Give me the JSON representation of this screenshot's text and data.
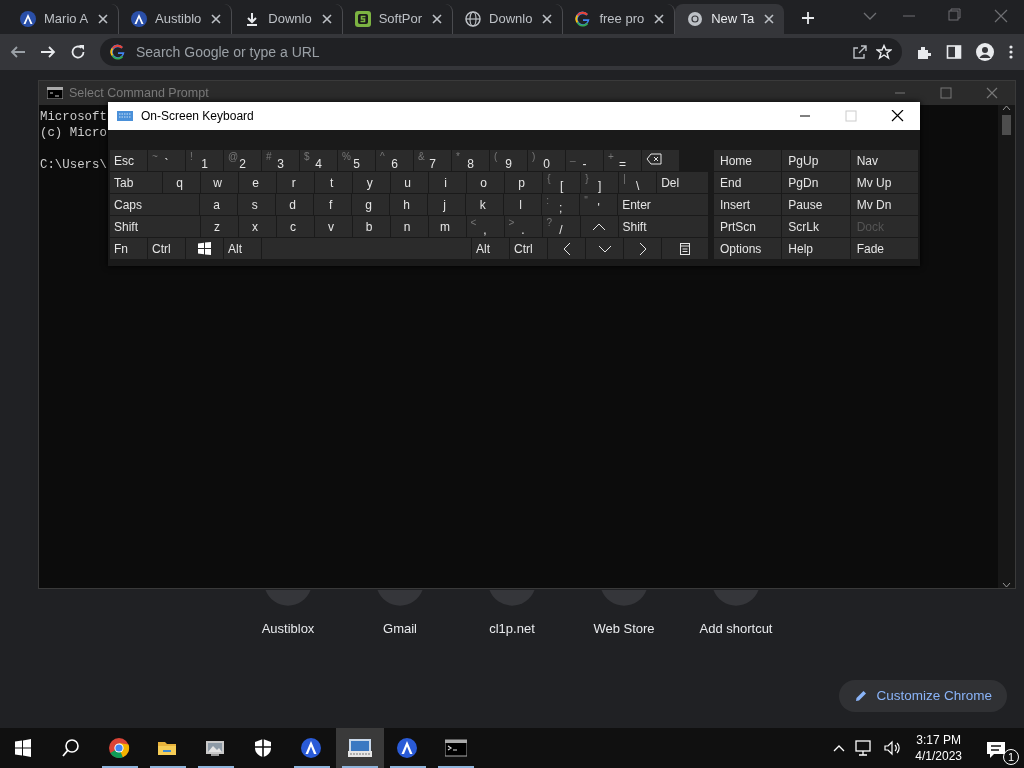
{
  "browser": {
    "tabs": [
      {
        "kind": "a-logo",
        "title": "Mario A",
        "selected": false
      },
      {
        "kind": "a-logo",
        "title": "Austiblo",
        "selected": false
      },
      {
        "kind": "download",
        "title": "Downlo",
        "selected": false
      },
      {
        "kind": "s-logo",
        "title": "SoftPor",
        "selected": false
      },
      {
        "kind": "globe",
        "title": "Downlo",
        "selected": false
      },
      {
        "kind": "google",
        "title": "free pro",
        "selected": false
      },
      {
        "kind": "chrome",
        "title": "New Ta",
        "selected": true
      }
    ],
    "omnibox": {
      "placeholder": "Search Google or type a URL"
    }
  },
  "new_tab": {
    "shortcuts": [
      {
        "label": "Austiblox"
      },
      {
        "label": "Gmail"
      },
      {
        "label": "cl1p.net"
      },
      {
        "label": "Web Store"
      },
      {
        "label": "Add shortcut"
      }
    ],
    "customize_button": "Customize Chrome"
  },
  "cmd_window": {
    "title": "Select Command Prompt",
    "paragraphs": [
      [
        "Microsoft",
        "(c) Micro"
      ],
      [
        "C:\\Users\\"
      ]
    ]
  },
  "osk": {
    "title": "On-Screen Keyboard",
    "rows": [
      {
        "keys": [
          {
            "kind": "label",
            "label": "Esc"
          },
          {
            "kind": "dual",
            "sub": "~",
            "label": "`"
          },
          {
            "kind": "dual",
            "sub": "!",
            "label": "1"
          },
          {
            "kind": "dual",
            "sub": "@",
            "label": "2"
          },
          {
            "kind": "dual",
            "sub": "#",
            "label": "3"
          },
          {
            "kind": "dual",
            "sub": "$",
            "label": "4"
          },
          {
            "kind": "dual",
            "sub": "%",
            "label": "5"
          },
          {
            "kind": "dual",
            "sub": "^",
            "label": "6"
          },
          {
            "kind": "dual",
            "sub": "&",
            "label": "7"
          },
          {
            "kind": "dual",
            "sub": "*",
            "label": "8"
          },
          {
            "kind": "dual",
            "sub": "(",
            "label": "9"
          },
          {
            "kind": "dual",
            "sub": ")",
            "label": "0"
          },
          {
            "kind": "dual",
            "sub": "_",
            "label": "-"
          },
          {
            "kind": "dual",
            "sub": "+",
            "label": "="
          },
          {
            "kind": "backspace"
          }
        ]
      },
      {
        "keys": [
          {
            "kind": "stretch",
            "label": "Tab"
          },
          {
            "kind": "char",
            "label": "q"
          },
          {
            "kind": "char",
            "label": "w"
          },
          {
            "kind": "char",
            "label": "e"
          },
          {
            "kind": "char",
            "label": "r"
          },
          {
            "kind": "char",
            "label": "t"
          },
          {
            "kind": "char",
            "label": "y"
          },
          {
            "kind": "char",
            "label": "u"
          },
          {
            "kind": "char",
            "label": "i"
          },
          {
            "kind": "char",
            "label": "o"
          },
          {
            "kind": "char",
            "label": "p"
          },
          {
            "kind": "dual",
            "sub": "{",
            "label": "["
          },
          {
            "kind": "dual",
            "sub": "}",
            "label": "]"
          },
          {
            "kind": "dual",
            "sub": "|",
            "label": "\\"
          },
          {
            "kind": "stretch",
            "label": "Del"
          }
        ]
      },
      {
        "keys": [
          {
            "kind": "stretch",
            "label": "Caps"
          },
          {
            "kind": "char",
            "label": "a"
          },
          {
            "kind": "char",
            "label": "s"
          },
          {
            "kind": "char",
            "label": "d"
          },
          {
            "kind": "char",
            "label": "f"
          },
          {
            "kind": "char",
            "label": "g"
          },
          {
            "kind": "char",
            "label": "h"
          },
          {
            "kind": "char",
            "label": "j"
          },
          {
            "kind": "char",
            "label": "k"
          },
          {
            "kind": "char",
            "label": "l"
          },
          {
            "kind": "dual",
            "sub": ":",
            "label": ";"
          },
          {
            "kind": "dual",
            "sub": "\"",
            "label": "'"
          },
          {
            "kind": "stretch",
            "label": "Enter"
          }
        ]
      },
      {
        "keys": [
          {
            "kind": "stretch",
            "label": "Shift"
          },
          {
            "kind": "char",
            "label": "z"
          },
          {
            "kind": "char",
            "label": "x"
          },
          {
            "kind": "char",
            "label": "c"
          },
          {
            "kind": "char",
            "label": "v"
          },
          {
            "kind": "char",
            "label": "b"
          },
          {
            "kind": "char",
            "label": "n"
          },
          {
            "kind": "char",
            "label": "m"
          },
          {
            "kind": "dual",
            "sub": "<",
            "label": ","
          },
          {
            "kind": "dual",
            "sub": ">",
            "label": "."
          },
          {
            "kind": "dual",
            "sub": "?",
            "label": "/"
          },
          {
            "kind": "up"
          },
          {
            "kind": "stretch",
            "label": "Shift"
          }
        ]
      },
      {
        "keys": [
          {
            "kind": "label",
            "label": "Fn"
          },
          {
            "kind": "label",
            "label": "Ctrl"
          },
          {
            "kind": "windows"
          },
          {
            "kind": "label",
            "label": "Alt"
          },
          {
            "kind": "space"
          },
          {
            "kind": "label",
            "label": "Alt"
          },
          {
            "kind": "label",
            "label": "Ctrl"
          },
          {
            "kind": "left"
          },
          {
            "kind": "down"
          },
          {
            "kind": "right"
          },
          {
            "kind": "menu"
          }
        ]
      }
    ],
    "nav_keys": [
      {
        "label": "Home",
        "disabled": false
      },
      {
        "label": "PgUp",
        "disabled": false
      },
      {
        "label": "Nav",
        "disabled": false
      },
      {
        "label": "End",
        "disabled": false
      },
      {
        "label": "PgDn",
        "disabled": false
      },
      {
        "label": "Mv Up",
        "disabled": false
      },
      {
        "label": "Insert",
        "disabled": false
      },
      {
        "label": "Pause",
        "disabled": false
      },
      {
        "label": "Mv Dn",
        "disabled": false
      },
      {
        "label": "PrtScn",
        "disabled": false
      },
      {
        "label": "ScrLk",
        "disabled": false
      },
      {
        "label": "Dock",
        "disabled": true
      },
      {
        "label": "Options",
        "disabled": false
      },
      {
        "label": "Help",
        "disabled": false
      },
      {
        "label": "Fade",
        "disabled": false
      }
    ]
  },
  "taskbar": {
    "items": [
      {
        "kind": "start",
        "running": false,
        "selected": false
      },
      {
        "kind": "search",
        "running": false,
        "selected": false
      },
      {
        "kind": "chrome",
        "running": true,
        "selected": false
      },
      {
        "kind": "folder",
        "running": true,
        "selected": false
      },
      {
        "kind": "viewer",
        "running": true,
        "selected": false
      },
      {
        "kind": "shield",
        "running": false,
        "selected": false
      },
      {
        "kind": "a-app",
        "running": true,
        "selected": false
      },
      {
        "kind": "keyboard",
        "running": true,
        "selected": true
      },
      {
        "kind": "a-app",
        "running": true,
        "selected": false
      },
      {
        "kind": "terminal",
        "running": true,
        "selected": false
      }
    ],
    "clock": {
      "time": "3:17 PM",
      "date": "4/1/2023"
    },
    "notifications": "1"
  }
}
